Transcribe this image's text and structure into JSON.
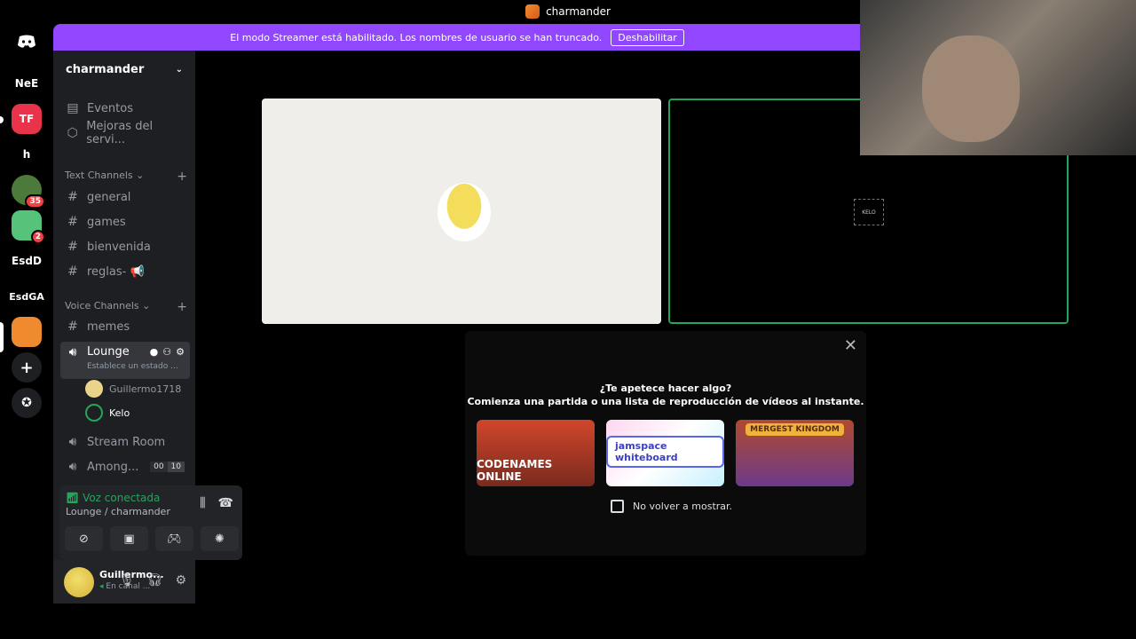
{
  "window": {
    "title": "charmander"
  },
  "banner": {
    "message": "El modo Streamer está habilitado. Los nombres de usuario se han truncado.",
    "button": "Deshabilitar"
  },
  "rail": {
    "servers": [
      {
        "label": "NeE"
      },
      {
        "label": "h"
      },
      {
        "label": "EsdD"
      },
      {
        "label": "EsdGA"
      }
    ],
    "badges": [
      "35",
      "2"
    ]
  },
  "sidebar": {
    "server_name": "charmander",
    "top_items": [
      {
        "label": "Eventos"
      },
      {
        "label": "Mejoras del servi..."
      }
    ],
    "text_category": "Text Channels",
    "text_channels": [
      {
        "name": "general"
      },
      {
        "name": "games"
      },
      {
        "name": "bienvenida"
      },
      {
        "name": "reglas- 📢"
      }
    ],
    "voice_category": "Voice Channels",
    "voice_channels": [
      {
        "name": "memes"
      },
      {
        "name": "Lounge",
        "status": "Establece un estado ..."
      },
      {
        "name": "Stream Room"
      },
      {
        "name": "Among...",
        "counts": [
          "00",
          "10"
        ]
      }
    ],
    "lounge_users": [
      {
        "name": "Guillermo1718"
      },
      {
        "name": "Kelo"
      }
    ]
  },
  "voice": {
    "status": "Voz conectada",
    "location": "Lounge / charmander"
  },
  "user": {
    "name": "Guillermo...",
    "status": "En canal ..."
  },
  "stage": {
    "right_tile_label": "KELO"
  },
  "popup": {
    "title": "¿Te apetece hacer algo?",
    "subtitle": "Comienza una partida o una lista de reproducción de vídeos al instante.",
    "activities": [
      {
        "name": "CODENAMES ONLINE"
      },
      {
        "name": "jamspace whiteboard"
      },
      {
        "name": "MERGEST KINGDOM"
      }
    ],
    "checkbox_label": "No volver a mostrar."
  },
  "colors": {
    "banner": "#9147ff",
    "connected": "#23a55a",
    "badge": "#f23f43"
  }
}
